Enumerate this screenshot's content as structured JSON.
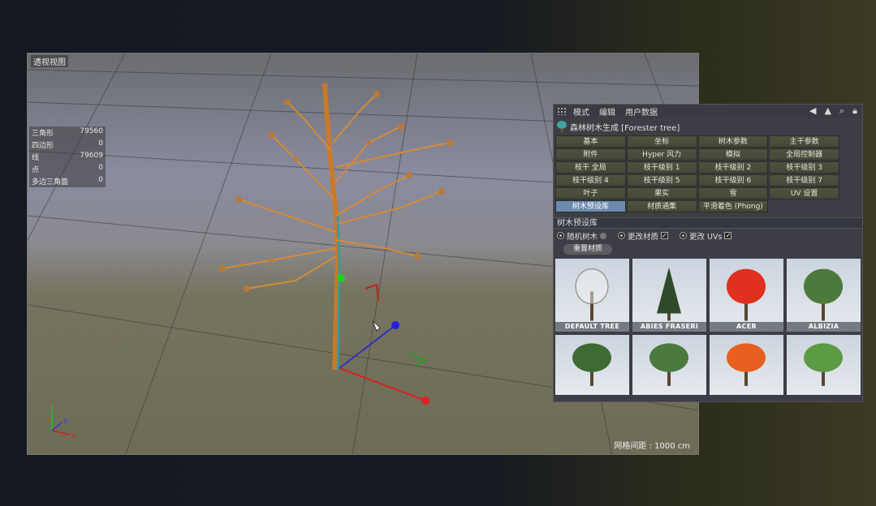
{
  "viewport": {
    "title": "透视视图",
    "stats": [
      {
        "label": "三角形",
        "value": "79560"
      },
      {
        "label": "四边形",
        "value": "0"
      },
      {
        "label": "线",
        "value": "79609"
      },
      {
        "label": "点",
        "value": "0"
      },
      {
        "label": "多边三角面",
        "value": "0"
      }
    ],
    "grid_spacing": "网格间距 : 1000 cm",
    "axis_labels": {
      "x": "X",
      "y": "Y",
      "z": "Z"
    }
  },
  "panel": {
    "menu": [
      "模式",
      "编辑",
      "用户数据"
    ],
    "object_title": "森林树木生成 [Forester tree]",
    "tabs": [
      [
        "基本",
        "坐标",
        "树木参数",
        "主干参数"
      ],
      [
        "附件",
        "Hyper 风力",
        "模拟",
        "全局控制器"
      ],
      [
        "枝干 全局",
        "枝干级别 1",
        "枝干级别 2",
        "枝干级别 3"
      ],
      [
        "枝干级别 4",
        "枝干级别 5",
        "枝干级别 6",
        "枝干级别 7"
      ],
      [
        "叶子",
        "果实",
        "雪",
        "UV 设置"
      ],
      [
        "树木预设库",
        "材质通集",
        "平滑着色 (Phong)",
        ""
      ]
    ],
    "active_tab": "树木预设库",
    "section_title": "树木预设库",
    "options": {
      "random_tree": "随机树木",
      "change_material": "更改材质",
      "change_uvs": "更改 UVs",
      "change_material_checked": "✓",
      "change_uvs_checked": "✓"
    },
    "reset_button": "重置材质",
    "presets": [
      {
        "name": "DEFAULT TREE",
        "color": "#f2f2f2"
      },
      {
        "name": "ABIES FRASERI",
        "color": "#2e4a2a"
      },
      {
        "name": "ACER",
        "color": "#e03020"
      },
      {
        "name": "ALBIZIA",
        "color": "#4c7a3c"
      },
      {
        "name": "",
        "color": "#3e6a34"
      },
      {
        "name": "",
        "color": "#4a7a3e"
      },
      {
        "name": "",
        "color": "#e86020"
      },
      {
        "name": "",
        "color": "#5c9a44"
      }
    ]
  }
}
